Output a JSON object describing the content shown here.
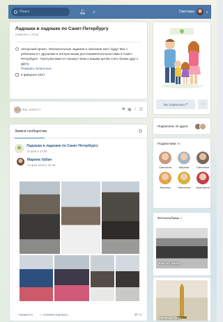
{
  "topbar": {
    "search_placeholder": "Поиск",
    "user_name": "Светлана"
  },
  "group": {
    "title": "Ладошка в ладошке по Санкт-Петербургу",
    "edit_status": "изменить статус",
    "description": "Авторский проект. Увлекательные задания и описания мест будут Вас с ребенком и с друзьями и интересными достопримечательностями в Санкт-Петербурге . Прогулки вместе покажут! Вам и вашим детям стать ближе друг к другу.",
    "show_more": "Показать полностью...",
    "created": "6 февраля 2017"
  },
  "newpost": {
    "placeholder": "Что у Вас нового?"
  },
  "feed": {
    "tab_label": "Записи сообщества",
    "post": {
      "author": "Ладошка в ладошке по Санкт-Петербургу",
      "date": "14 фев в 23:55",
      "repost_author": "Марина Урбан",
      "repost_date": "14 фев 2018 в 20:38"
    },
    "like_label": "Нравится",
    "comment_label": "Комментировать",
    "views": "57"
  },
  "sidebar": {
    "subscribed_label": "Вы подписаны",
    "more_label": "···",
    "friends_label": "Подписаны 24 друга",
    "subscribers_title": "Подписчики",
    "subscribers_count": "90",
    "subscribers": [
      {
        "name": "Светлана",
        "color": "#c79a7a"
      },
      {
        "name": "Марина",
        "color": "#a7b6c4"
      },
      {
        "name": "Светлана",
        "color": "#7a6a5e"
      },
      {
        "name": "Евгения",
        "color": "#e3a34a"
      },
      {
        "name": "Светлана",
        "color": "#d7b23a"
      },
      {
        "name": "Анастасия",
        "color": "#c2404a"
      }
    ],
    "albums_title": "Фотоальбомы",
    "albums_count": "4",
    "album1_caption": "Как это было",
    "album2_caption": "ТВОРЧЕСТВО"
  },
  "colors": {
    "brand": "#4a76a8",
    "link": "#2a5885"
  }
}
